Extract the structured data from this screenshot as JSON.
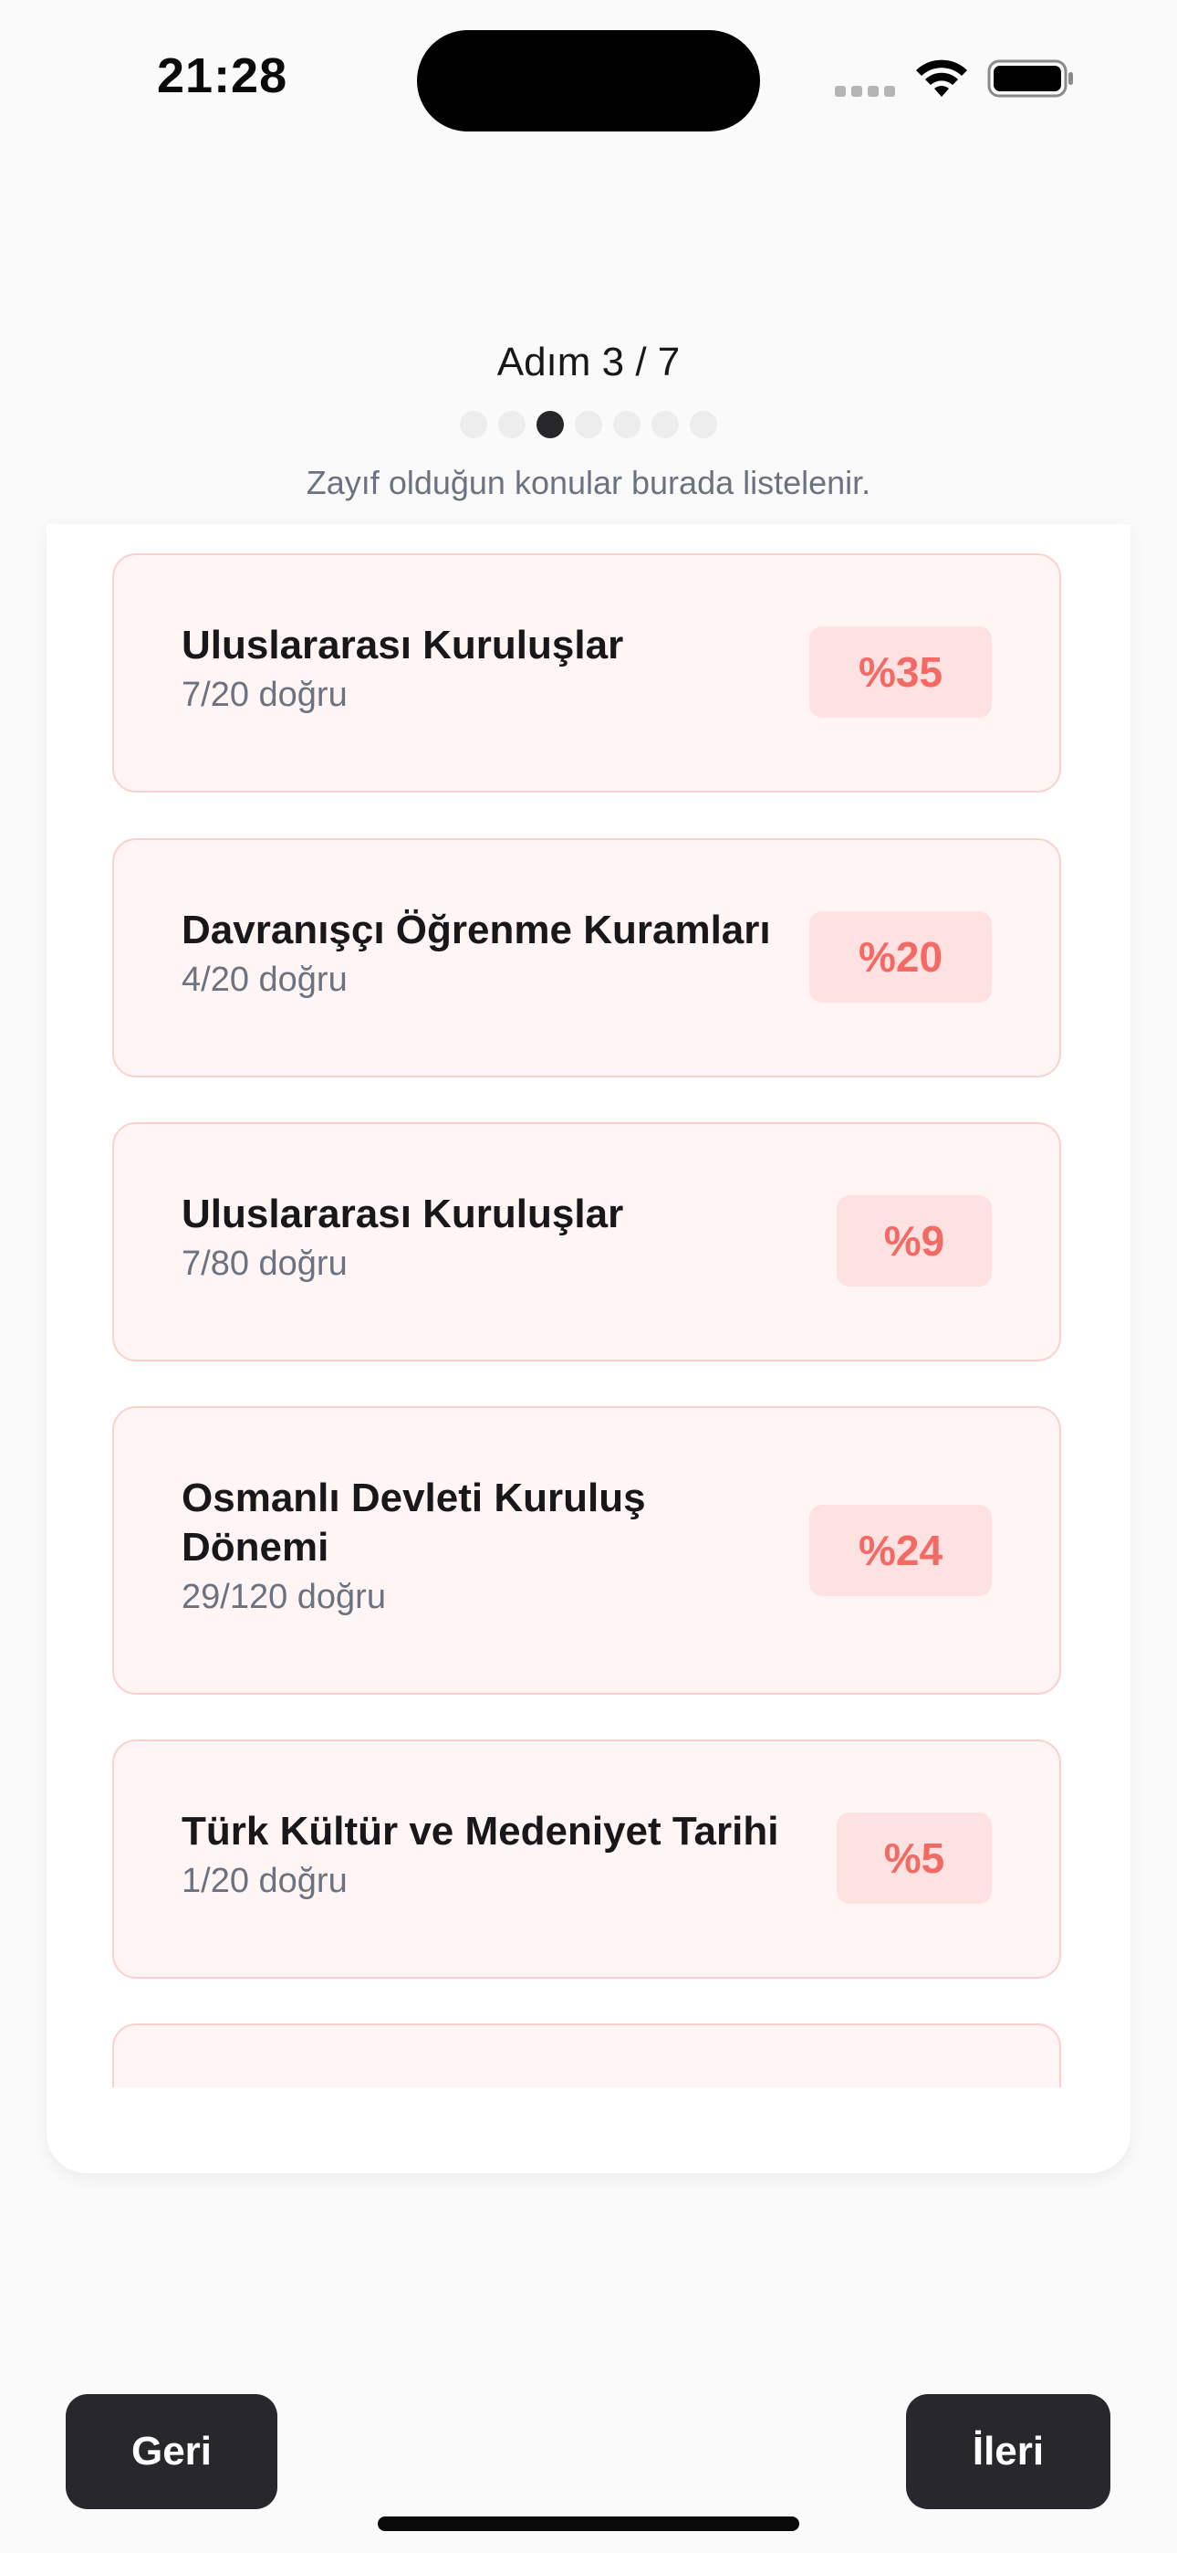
{
  "status_bar": {
    "time": "21:28"
  },
  "header": {
    "step_label": "Adım 3 / 7",
    "total_steps": 7,
    "current_step": 3,
    "subtitle": "Zayıf olduğun konular burada listelenir."
  },
  "topics": [
    {
      "name": "Uluslararası Kuruluşlar",
      "score": "7/20 doğru",
      "percent": "%35"
    },
    {
      "name": "Davranışçı Öğrenme Kuramları",
      "score": "4/20 doğru",
      "percent": "%20"
    },
    {
      "name": "Uluslararası Kuruluşlar",
      "score": "7/80 doğru",
      "percent": "%9"
    },
    {
      "name": "Osmanlı Devleti Kuruluş Dönemi",
      "score": "29/120 doğru",
      "percent": "%24"
    },
    {
      "name": "Türk Kültür ve Medeniyet Tarihi",
      "score": "1/20 doğru",
      "percent": "%5"
    }
  ],
  "buttons": {
    "back": "Geri",
    "next": "İleri"
  },
  "colors": {
    "card_bg": "#fff5f4",
    "card_border": "#fbd0cd",
    "badge_bg": "#fde2e1",
    "badge_text": "#f36a64",
    "button_bg": "#28272c"
  }
}
